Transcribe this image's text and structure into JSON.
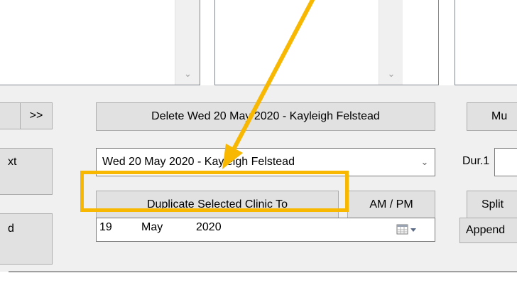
{
  "nav": {
    "next_label": ">>"
  },
  "left_partial_buttons": [
    {
      "label": "xt"
    },
    {
      "label": "d"
    }
  ],
  "delete_button": {
    "label": "Delete Wed 20 May 2020 - Kayleigh Felstead"
  },
  "clinic_select": {
    "value": "Wed 20 May 2020 - Kayleigh Felstead"
  },
  "duplicate_button": {
    "label": "Duplicate Selected Clinic To"
  },
  "ampm_button": {
    "label": "AM / PM"
  },
  "date_picker": {
    "day": "19",
    "month": "May",
    "year": "2020"
  },
  "right_column": {
    "top_button_label": "Mu",
    "duration_label": "Dur.1",
    "split_button_label": "Split",
    "append_button_label": "Append"
  },
  "colors": {
    "annotation": "#f8b700",
    "panel_bg": "#f0f0f0",
    "button_bg": "#e1e1e1",
    "button_border": "#adadad"
  },
  "icons": {
    "calendar": "calendar-icon",
    "dropdown": "chevron-down-icon",
    "annotation_arrow": "arrow-icon"
  }
}
